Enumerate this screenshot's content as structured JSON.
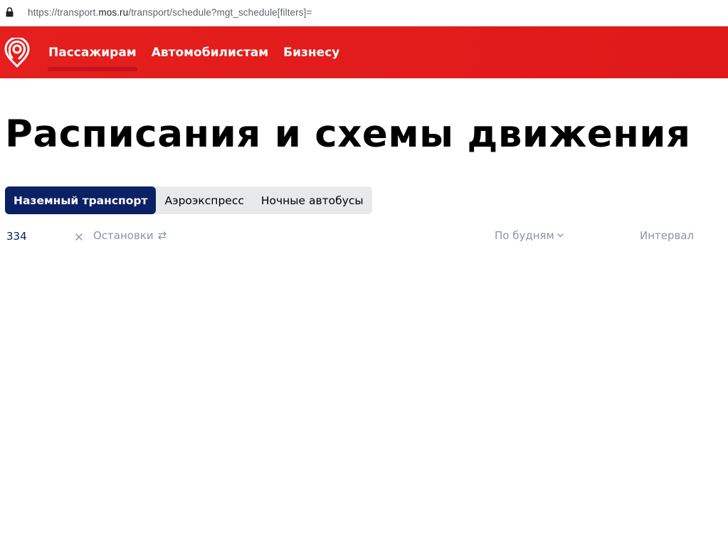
{
  "browser": {
    "url_prefix": "https://transport.",
    "url_host": "mos.ru",
    "url_rest": "/transport/schedule?mgt_schedule[filters]="
  },
  "header": {
    "nav": [
      {
        "label": "Пассажирам",
        "active": true
      },
      {
        "label": "Автомобилистам",
        "active": false
      },
      {
        "label": "Бизнесу",
        "active": false
      }
    ]
  },
  "page": {
    "title": "Расписания и схемы движения"
  },
  "tabs": [
    {
      "label": "Наземный транспорт",
      "active": true
    },
    {
      "label": "Аэроэкспресс",
      "active": false
    },
    {
      "label": "Ночные автобусы",
      "active": false
    }
  ],
  "filters": {
    "route_value": "334",
    "stops_label": "Остановки",
    "daytype_label": "По будням",
    "interval_label": "Интервал"
  },
  "colors": {
    "brand_red": "#e41f1d",
    "active_tab": "#0b2165",
    "muted_text": "#8a94a6"
  },
  "icons": {
    "logo": "metro-logo-icon",
    "lock": "lock-icon",
    "clear": "close-icon",
    "swap": "swap-arrows-icon",
    "chevron": "chevron-down-icon"
  }
}
